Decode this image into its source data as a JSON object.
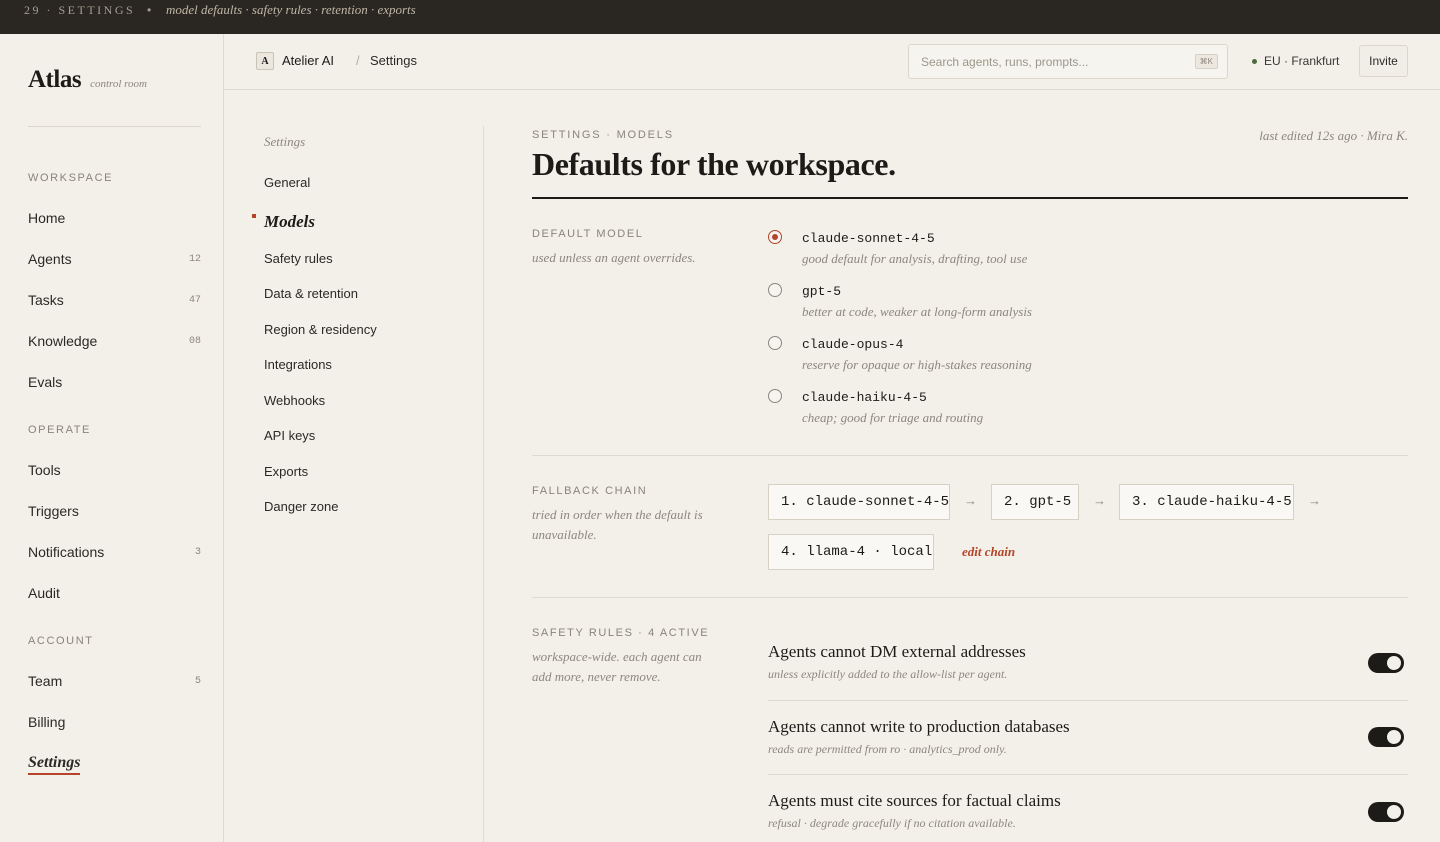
{
  "topstrip": {
    "index": "29 · SETTINGS",
    "dot": "•",
    "description": "model defaults · safety rules · retention · exports"
  },
  "brand": {
    "name": "Atlas",
    "tagline": "control room"
  },
  "sidebar": {
    "sections": [
      {
        "heading": "WORKSPACE",
        "items": [
          {
            "label": "Home",
            "count": ""
          },
          {
            "label": "Agents",
            "count": "12"
          },
          {
            "label": "Tasks",
            "count": "47"
          },
          {
            "label": "Knowledge",
            "count": "08"
          },
          {
            "label": "Evals",
            "count": ""
          }
        ]
      },
      {
        "heading": "OPERATE",
        "items": [
          {
            "label": "Tools",
            "count": ""
          },
          {
            "label": "Triggers",
            "count": ""
          },
          {
            "label": "Notifications",
            "count": "3"
          },
          {
            "label": "Audit",
            "count": ""
          }
        ]
      },
      {
        "heading": "ACCOUNT",
        "items": [
          {
            "label": "Team",
            "count": "5"
          },
          {
            "label": "Billing",
            "count": ""
          },
          {
            "label": "Settings",
            "count": "",
            "active": true
          }
        ]
      }
    ]
  },
  "header": {
    "workspace_badge": "A",
    "workspace_name": "Atelier AI",
    "crumb_sep": "/",
    "crumb_page": "Settings",
    "search_placeholder": "Search agents, runs, prompts...",
    "search_shortcut": "⌘K",
    "region": "EU · Frankfurt",
    "invite_label": "Invite"
  },
  "subnav": {
    "title": "Settings",
    "items": [
      "General",
      "Models",
      "Safety rules",
      "Data & retention",
      "Region & residency",
      "Integrations",
      "Webhooks",
      "API keys",
      "Exports",
      "Danger zone"
    ],
    "active": "Models"
  },
  "main": {
    "eyebrow": "SETTINGS · MODELS",
    "edited": "last edited 12s ago · Mira K.",
    "title": "Defaults for the workspace.",
    "default_model": {
      "label": "DEFAULT MODEL",
      "desc": "used unless an agent overrides.",
      "options": [
        {
          "name": "claude-sonnet-4-5",
          "note": "good default for analysis, drafting, tool use",
          "selected": true
        },
        {
          "name": "gpt-5",
          "note": "better at code, weaker at long-form analysis",
          "selected": false
        },
        {
          "name": "claude-opus-4",
          "note": "reserve for opaque or high-stakes reasoning",
          "selected": false
        },
        {
          "name": "claude-haiku-4-5",
          "note": "cheap; good for triage and routing",
          "selected": false
        }
      ]
    },
    "fallback": {
      "label": "FALLBACK CHAIN",
      "desc": "tried in order when the default is unavailable.",
      "chain": [
        "1. claude-sonnet-4-5",
        "2. gpt-5",
        "3. claude-haiku-4-5",
        "4. llama-4 · local"
      ],
      "arrow": "→",
      "edit_label": "edit chain"
    },
    "safety": {
      "label": "SAFETY RULES · 4 ACTIVE",
      "desc": "workspace-wide. each agent can add more, never remove.",
      "rules": [
        {
          "title": "Agents cannot DM external addresses",
          "desc": "unless explicitly added to the allow-list per agent.",
          "enabled": true
        },
        {
          "title": "Agents cannot write to production databases",
          "desc": "reads are permitted from ro · analytics_prod only.",
          "enabled": true
        },
        {
          "title": "Agents must cite sources for factual claims",
          "desc": "refusal · degrade gracefully if no citation available.",
          "enabled": true
        }
      ]
    }
  },
  "colors": {
    "accent": "#b5442a",
    "ink": "#1d1b18",
    "paper": "#f3f0ea",
    "muted": "#8d877c",
    "status_ok": "#4d6b3c"
  }
}
